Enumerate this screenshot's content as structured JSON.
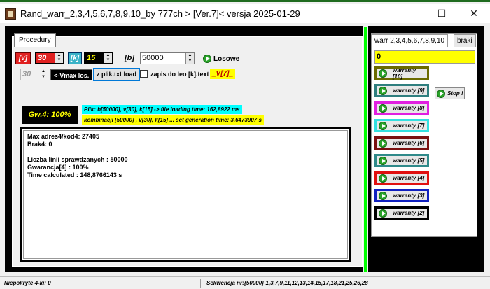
{
  "window": {
    "title": "Rand_warr_2,3,4,5,6,7,8,9,10_by 777ch > [Ver.7]<   versja 2025-01-29",
    "minimize": "—",
    "maximize": "☐",
    "close": "✕"
  },
  "left": {
    "tab_label": "Procedury",
    "v_label": "[v]",
    "v_value": "30",
    "k_label": "[k]",
    "k_value": "15",
    "b_label": "[b]",
    "b_value": "50000",
    "losowe_label": "Losowe",
    "vmax_value": "30",
    "vmax_button": "<-Vmax los.",
    "zplik_button": "z plik.txt load",
    "zapis_checkbox": "zapis do leo [k].text",
    "v7_label": "_V[7]_",
    "gw_label": "Gw.4: 100%",
    "info_cyan": "Plik: b[50000], v[30], k[15]  -> file loading time: 162,8922 ms",
    "info_yellow": "kombinacji [50000] , v[30], k[15] ... set generation time: 3,6473907 s",
    "output_lines": [
      "Max adres4/kod4: 27405",
      "Brak4: 0",
      "",
      "Liczba linii sprawdzanych : 50000",
      "Gwarancja[4] : 100%",
      "Time calculated : 148,8766143 s"
    ]
  },
  "right": {
    "tab_warr": "warr 2,3,4,5,6,7,8,9,10",
    "tab_braki": "braki",
    "yellow_value": "0",
    "stop_label": "Stop !",
    "warranty_buttons": [
      {
        "label": "warranty [10]",
        "color": "#6b6b00"
      },
      {
        "label": "warranty [9]",
        "color": "#2f7f7f"
      },
      {
        "label": "warranty [8]",
        "color": "#e020e0"
      },
      {
        "label": "warranty [7]",
        "color": "#33e0e0"
      },
      {
        "label": "warranty [6]",
        "color": "#7a1010"
      },
      {
        "label": "warranty [5]",
        "color": "#2f8a8a"
      },
      {
        "label": "warranty [4]",
        "color": "#e01010"
      },
      {
        "label": "warranty [3]",
        "color": "#1020c0"
      },
      {
        "label": "warranty [2]",
        "color": "#000000"
      }
    ]
  },
  "status": {
    "left": "Niepokryte 4-ki: 0",
    "right": "Sekwencja nr:{50000}  1,3,7,9,11,12,13,14,15,17,18,21,25,26,28"
  }
}
